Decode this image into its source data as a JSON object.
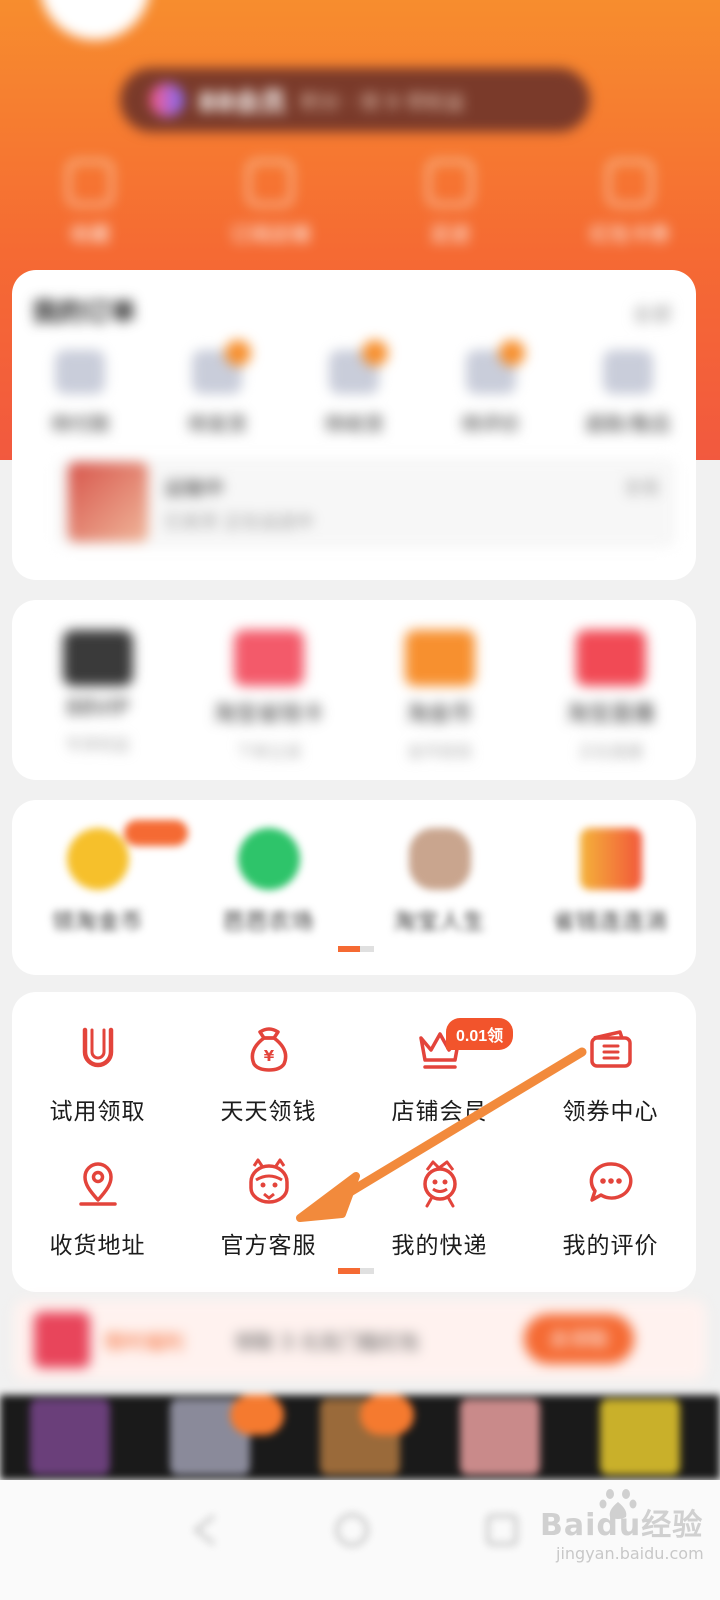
{
  "header": {
    "vip_name": "88会员",
    "vip_desc": "积分 · 领 9 项权益"
  },
  "quick_links": [
    {
      "label": "收藏"
    },
    {
      "label": "订阅店铺"
    },
    {
      "label": "足迹"
    },
    {
      "label": "红包卡券"
    }
  ],
  "orders": {
    "title": "我的订单",
    "more": "全部",
    "items": [
      {
        "label": "待付款"
      },
      {
        "label": "待发货"
      },
      {
        "label": "待收货"
      },
      {
        "label": "待评价"
      },
      {
        "label": "退款/售后"
      }
    ],
    "strip": {
      "title": "运输中",
      "sub": "已发货 正在运送中",
      "right": "查看"
    }
  },
  "services": [
    {
      "label": "88VIP",
      "sub": "专享权益",
      "color": "#3a3a3a"
    },
    {
      "label": "淘宝省钱卡",
      "sub": "下单立减",
      "color": "#f35a6a"
    },
    {
      "label": "淘金币",
      "sub": "金币抵钱",
      "color": "#f7902f"
    },
    {
      "label": "淘宝直播",
      "sub": "正在直播",
      "color": "#f14a55"
    }
  ],
  "games": [
    {
      "label": "领淘金币",
      "color": "#f6c02b"
    },
    {
      "label": "芭芭农场",
      "color": "#2ec46a"
    },
    {
      "label": "淘宝人生",
      "color": "#c9a58e"
    },
    {
      "label": "省钱连连消",
      "color": "#f4b43a"
    }
  ],
  "tools": [
    {
      "label": "试用领取",
      "icon": "trial-icon"
    },
    {
      "label": "天天领钱",
      "icon": "money-bag-icon"
    },
    {
      "label": "店铺会员",
      "icon": "crown-icon",
      "badge": "0.01领"
    },
    {
      "label": "领券中心",
      "icon": "coupon-icon"
    },
    {
      "label": "收货地址",
      "icon": "location-pin-icon"
    },
    {
      "label": "官方客服",
      "icon": "customer-service-icon"
    },
    {
      "label": "我的快递",
      "icon": "delivery-icon"
    },
    {
      "label": "我的评价",
      "icon": "chat-bubble-icon"
    }
  ],
  "promo": {
    "tag": "限时福利",
    "text": "领取 3 元无门槛红包",
    "button": "去领取"
  },
  "watermark": {
    "brand": "Baidu经验",
    "url": "jingyan.baidu.com"
  },
  "colors": {
    "accent": "#f56a33",
    "icon_red": "#e3443b",
    "arrow": "#f28a3c"
  }
}
